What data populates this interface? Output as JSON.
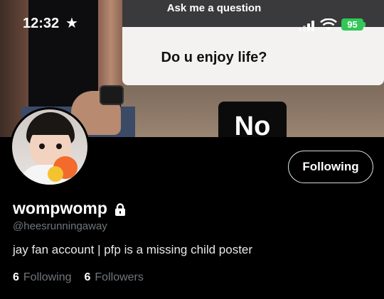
{
  "status_bar": {
    "time": "12:32",
    "star": "★",
    "battery": "95"
  },
  "banner": {
    "question_header": "Ask me a question",
    "question": "Do u enjoy life?",
    "answer": "No"
  },
  "profile": {
    "display_name": "wompwomp",
    "handle": "@heesrunningaway",
    "bio": "jay fan account | pfp is a missing child poster",
    "follow_button_label": "Following",
    "following_count": "6",
    "following_label": "Following",
    "followers_count": "6",
    "followers_label": "Followers"
  },
  "colors": {
    "background": "#000000",
    "secondary_text": "#71767b",
    "battery": "#32c759"
  }
}
